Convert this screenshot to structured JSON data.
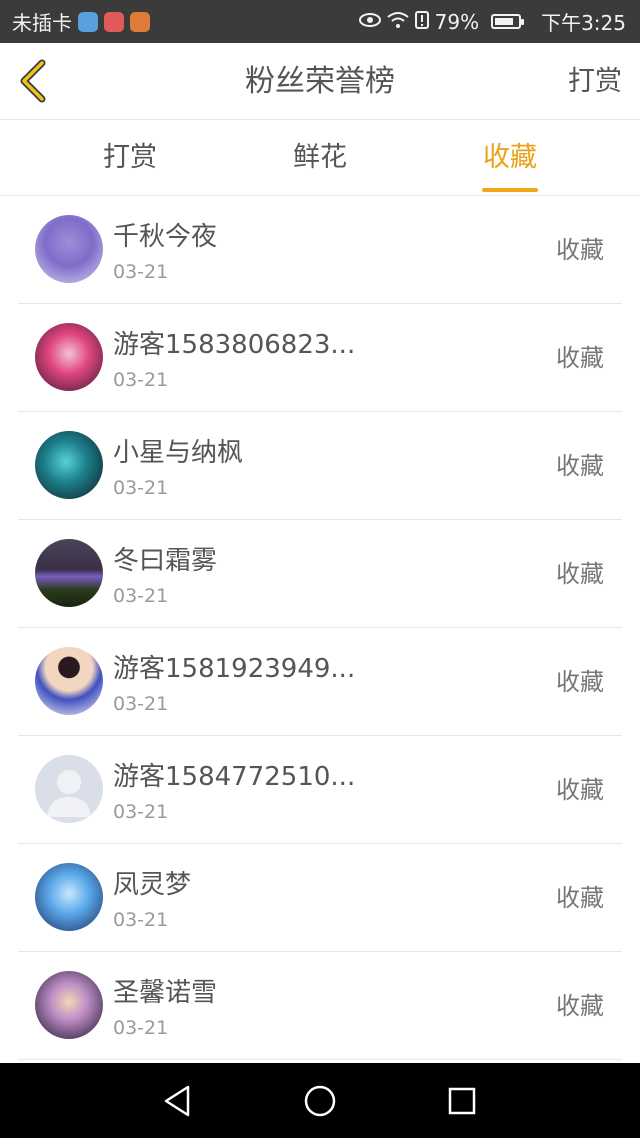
{
  "status_bar": {
    "carrier": "未插卡",
    "battery_percent": "79%",
    "time": "下午3:25"
  },
  "header": {
    "title": "粉丝荣誉榜",
    "right_action": "打赏"
  },
  "tabs": [
    {
      "label": "打赏",
      "active": false
    },
    {
      "label": "鲜花",
      "active": false
    },
    {
      "label": "收藏",
      "active": true
    }
  ],
  "accent_color": "#f0a818",
  "fans": [
    {
      "name": "千秋今夜",
      "date": "03-21",
      "action": "收藏"
    },
    {
      "name": "游客1583806823...",
      "date": "03-21",
      "action": "收藏"
    },
    {
      "name": "小星与纳枫",
      "date": "03-21",
      "action": "收藏"
    },
    {
      "name": "冬曰霜雾",
      "date": "03-21",
      "action": "收藏"
    },
    {
      "name": "游客1581923949...",
      "date": "03-21",
      "action": "收藏"
    },
    {
      "name": "游客1584772510...",
      "date": "03-21",
      "action": "收藏"
    },
    {
      "name": "凤灵梦",
      "date": "03-21",
      "action": "收藏"
    },
    {
      "name": "圣馨诺雪",
      "date": "03-21",
      "action": "收藏"
    }
  ]
}
